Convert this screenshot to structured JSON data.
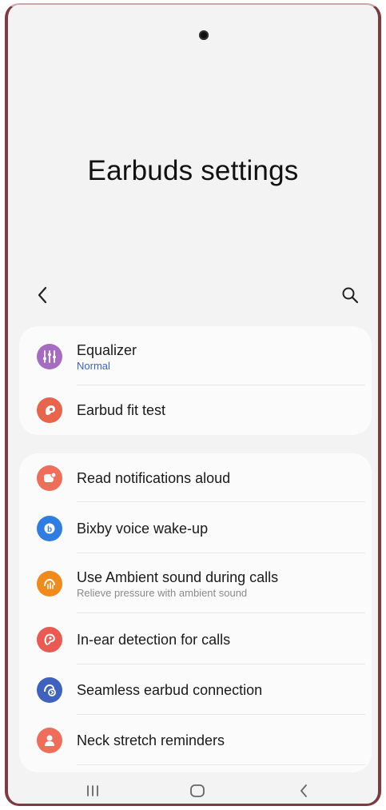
{
  "header": {
    "title": "Earbuds settings",
    "back_icon": "chevron-left-icon",
    "search_icon": "search-icon"
  },
  "group1": {
    "items": [
      {
        "label": "Equalizer",
        "sub": "Normal",
        "icon": "equalizer-icon",
        "color": "#a56cc1"
      },
      {
        "label": "Earbud fit test",
        "icon": "earbud-fit-icon",
        "color": "#e8644d"
      }
    ]
  },
  "group2": {
    "items": [
      {
        "label": "Read notifications aloud",
        "icon": "notification-voice-icon",
        "color": "#ee6e5a"
      },
      {
        "label": "Bixby voice wake-up",
        "icon": "bixby-icon",
        "color": "#2f7de1"
      },
      {
        "label": "Use Ambient sound during calls",
        "sub": "Relieve pressure with ambient sound",
        "icon": "ambient-sound-icon",
        "color": "#f08a1c"
      },
      {
        "label": "In-ear detection for calls",
        "icon": "in-ear-detection-icon",
        "color": "#ea5a52"
      },
      {
        "label": "Seamless earbud connection",
        "icon": "seamless-connection-icon",
        "color": "#3f62c0"
      },
      {
        "label": "Neck stretch reminders",
        "icon": "neck-stretch-icon",
        "color": "#ee6e5a"
      }
    ]
  },
  "navbar": {
    "recents_icon": "recents-icon",
    "home_icon": "home-icon",
    "back_icon": "back-icon"
  },
  "colors": {
    "accent": "#3c62c4",
    "background": "#f3f3f3",
    "card": "#fbfbfb",
    "frame": "#7a3b42"
  }
}
